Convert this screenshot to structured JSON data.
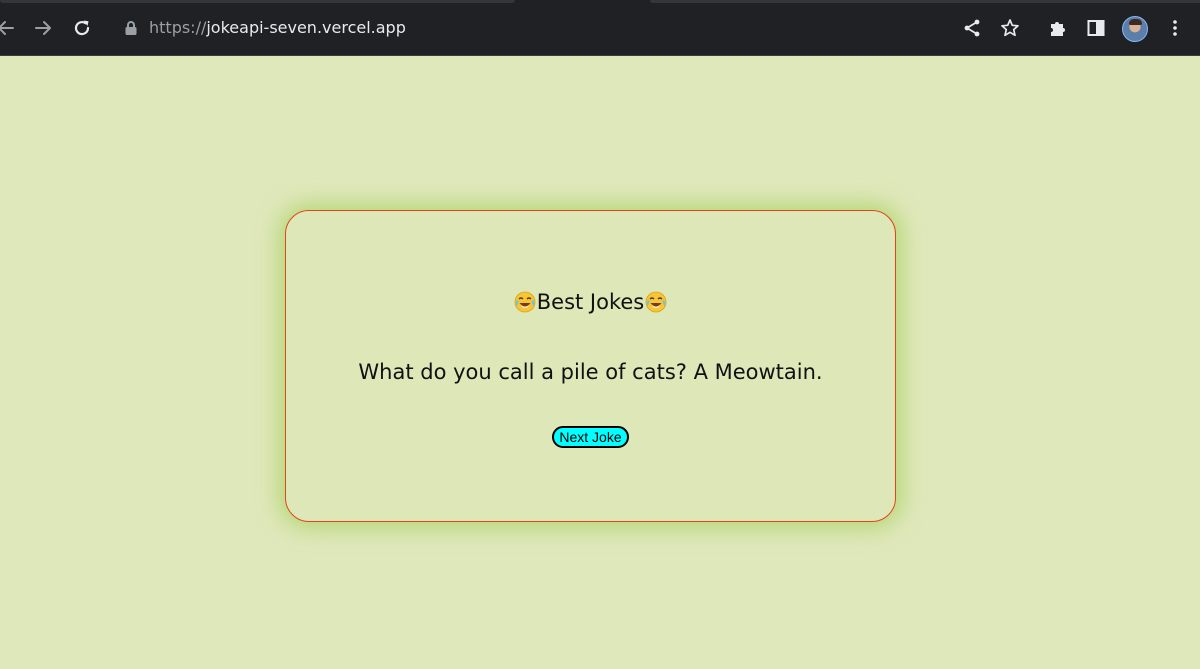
{
  "browser": {
    "url_scheme": "https://",
    "url_host": "jokeapi-seven.vercel.app"
  },
  "page": {
    "background_color": "#dfe8bb",
    "title": "Best Jokes",
    "joke": "What do you call a pile of cats? A Meowtain.",
    "next_button_label": "Next Joke",
    "accent_border_color": "#e4441c",
    "button_color": "#00ffff"
  },
  "icons": {
    "title_decoration": "face-with-tears-of-joy-icon"
  }
}
